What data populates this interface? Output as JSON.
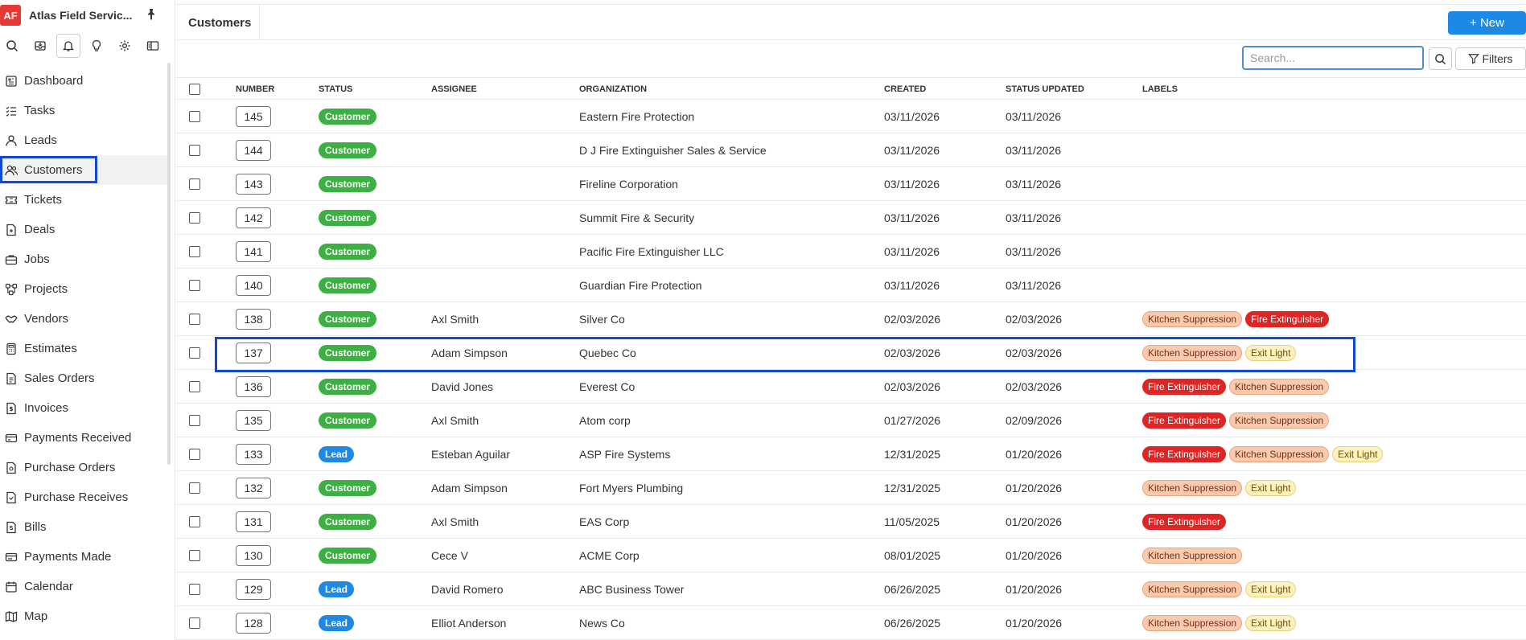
{
  "app": {
    "logo_text": "AF",
    "name": "Atlas Field Servic..."
  },
  "sidebar": {
    "tools": [
      "search-icon",
      "inbox-icon",
      "bell-icon",
      "bulb-icon",
      "gear-icon",
      "panel-icon"
    ],
    "items": [
      {
        "label": "Dashboard",
        "icon": "dashboard-icon"
      },
      {
        "label": "Tasks",
        "icon": "tasks-icon"
      },
      {
        "label": "Leads",
        "icon": "user-icon"
      },
      {
        "label": "Customers",
        "icon": "users-icon"
      },
      {
        "label": "Tickets",
        "icon": "ticket-icon"
      },
      {
        "label": "Deals",
        "icon": "deal-icon"
      },
      {
        "label": "Jobs",
        "icon": "briefcase-icon"
      },
      {
        "label": "Projects",
        "icon": "projects-icon"
      },
      {
        "label": "Vendors",
        "icon": "handshake-icon"
      },
      {
        "label": "Estimates",
        "icon": "calculator-icon"
      },
      {
        "label": "Sales Orders",
        "icon": "sales-order-icon"
      },
      {
        "label": "Invoices",
        "icon": "invoice-icon"
      },
      {
        "label": "Payments Received",
        "icon": "payment-icon"
      },
      {
        "label": "Purchase Orders",
        "icon": "purchase-order-icon"
      },
      {
        "label": "Purchase Receives",
        "icon": "receive-icon"
      },
      {
        "label": "Bills",
        "icon": "bill-icon"
      },
      {
        "label": "Payments Made",
        "icon": "payment-made-icon"
      },
      {
        "label": "Calendar",
        "icon": "calendar-icon"
      },
      {
        "label": "Map",
        "icon": "map-icon"
      }
    ]
  },
  "header": {
    "title": "Customers",
    "new_label": "+ New"
  },
  "toolbar": {
    "search_placeholder": "Search...",
    "filters_label": "Filters"
  },
  "table": {
    "columns": [
      "NUMBER",
      "STATUS",
      "ASSIGNEE",
      "ORGANIZATION",
      "CREATED",
      "STATUS UPDATED",
      "LABELS"
    ],
    "rows": [
      {
        "number": "145",
        "status": "Customer",
        "assignee": "",
        "organization": "Eastern Fire Protection",
        "created": "03/11/2026",
        "updated": "03/11/2026",
        "labels": []
      },
      {
        "number": "144",
        "status": "Customer",
        "assignee": "",
        "organization": "D J Fire Extinguisher Sales & Service",
        "created": "03/11/2026",
        "updated": "03/11/2026",
        "labels": []
      },
      {
        "number": "143",
        "status": "Customer",
        "assignee": "",
        "organization": "Fireline Corporation",
        "created": "03/11/2026",
        "updated": "03/11/2026",
        "labels": []
      },
      {
        "number": "142",
        "status": "Customer",
        "assignee": "",
        "organization": "Summit Fire & Security",
        "created": "03/11/2026",
        "updated": "03/11/2026",
        "labels": []
      },
      {
        "number": "141",
        "status": "Customer",
        "assignee": "",
        "organization": "Pacific Fire Extinguisher LLC",
        "created": "03/11/2026",
        "updated": "03/11/2026",
        "labels": []
      },
      {
        "number": "140",
        "status": "Customer",
        "assignee": "",
        "organization": "Guardian Fire Protection",
        "created": "03/11/2026",
        "updated": "03/11/2026",
        "labels": []
      },
      {
        "number": "138",
        "status": "Customer",
        "assignee": "Axl Smith",
        "organization": "Silver Co",
        "created": "02/03/2026",
        "updated": "02/03/2026",
        "labels": [
          "Kitchen Suppression",
          "Fire Extinguisher"
        ]
      },
      {
        "number": "137",
        "status": "Customer",
        "assignee": "Adam Simpson",
        "organization": "Quebec Co",
        "created": "02/03/2026",
        "updated": "02/03/2026",
        "labels": [
          "Kitchen Suppression",
          "Exit Light"
        ]
      },
      {
        "number": "136",
        "status": "Customer",
        "assignee": "David Jones",
        "organization": "Everest Co",
        "created": "02/03/2026",
        "updated": "02/03/2026",
        "labels": [
          "Fire Extinguisher",
          "Kitchen Suppression"
        ]
      },
      {
        "number": "135",
        "status": "Customer",
        "assignee": "Axl Smith",
        "organization": "Atom corp",
        "created": "01/27/2026",
        "updated": "02/09/2026",
        "labels": [
          "Fire Extinguisher",
          "Kitchen Suppression"
        ]
      },
      {
        "number": "133",
        "status": "Lead",
        "assignee": "Esteban Aguilar",
        "organization": "ASP Fire Systems",
        "created": "12/31/2025",
        "updated": "01/20/2026",
        "labels": [
          "Fire Extinguisher",
          "Kitchen Suppression",
          "Exit Light"
        ]
      },
      {
        "number": "132",
        "status": "Customer",
        "assignee": "Adam Simpson",
        "organization": "Fort Myers Plumbing",
        "created": "12/31/2025",
        "updated": "01/20/2026",
        "labels": [
          "Kitchen Suppression",
          "Exit Light"
        ]
      },
      {
        "number": "131",
        "status": "Customer",
        "assignee": "Axl Smith",
        "organization": "EAS Corp",
        "created": "11/05/2025",
        "updated": "01/20/2026",
        "labels": [
          "Fire Extinguisher"
        ]
      },
      {
        "number": "130",
        "status": "Customer",
        "assignee": "Cece V",
        "organization": "ACME Corp",
        "created": "08/01/2025",
        "updated": "01/20/2026",
        "labels": [
          "Kitchen Suppression"
        ]
      },
      {
        "number": "129",
        "status": "Lead",
        "assignee": "David Romero",
        "organization": "ABC Business Tower",
        "created": "06/26/2025",
        "updated": "01/20/2026",
        "labels": [
          "Kitchen Suppression",
          "Exit Light"
        ]
      },
      {
        "number": "128",
        "status": "Lead",
        "assignee": "Elliot Anderson",
        "organization": "News Co",
        "created": "06/26/2025",
        "updated": "01/20/2026",
        "labels": [
          "Kitchen Suppression",
          "Exit Light"
        ]
      }
    ]
  },
  "colors": {
    "status_customer": "#3cb043",
    "status_lead": "#1e88e5",
    "tag_kitchen_bg": "#f8cbb0",
    "tag_kitchen_text": "#7a2e0e",
    "tag_fire_bg": "#e02424",
    "tag_fire_text": "#ffffff",
    "tag_exit_bg": "#fdf1c2",
    "tag_exit_text": "#6b5200",
    "accent": "#1e88e5",
    "highlight": "#1249d3"
  }
}
